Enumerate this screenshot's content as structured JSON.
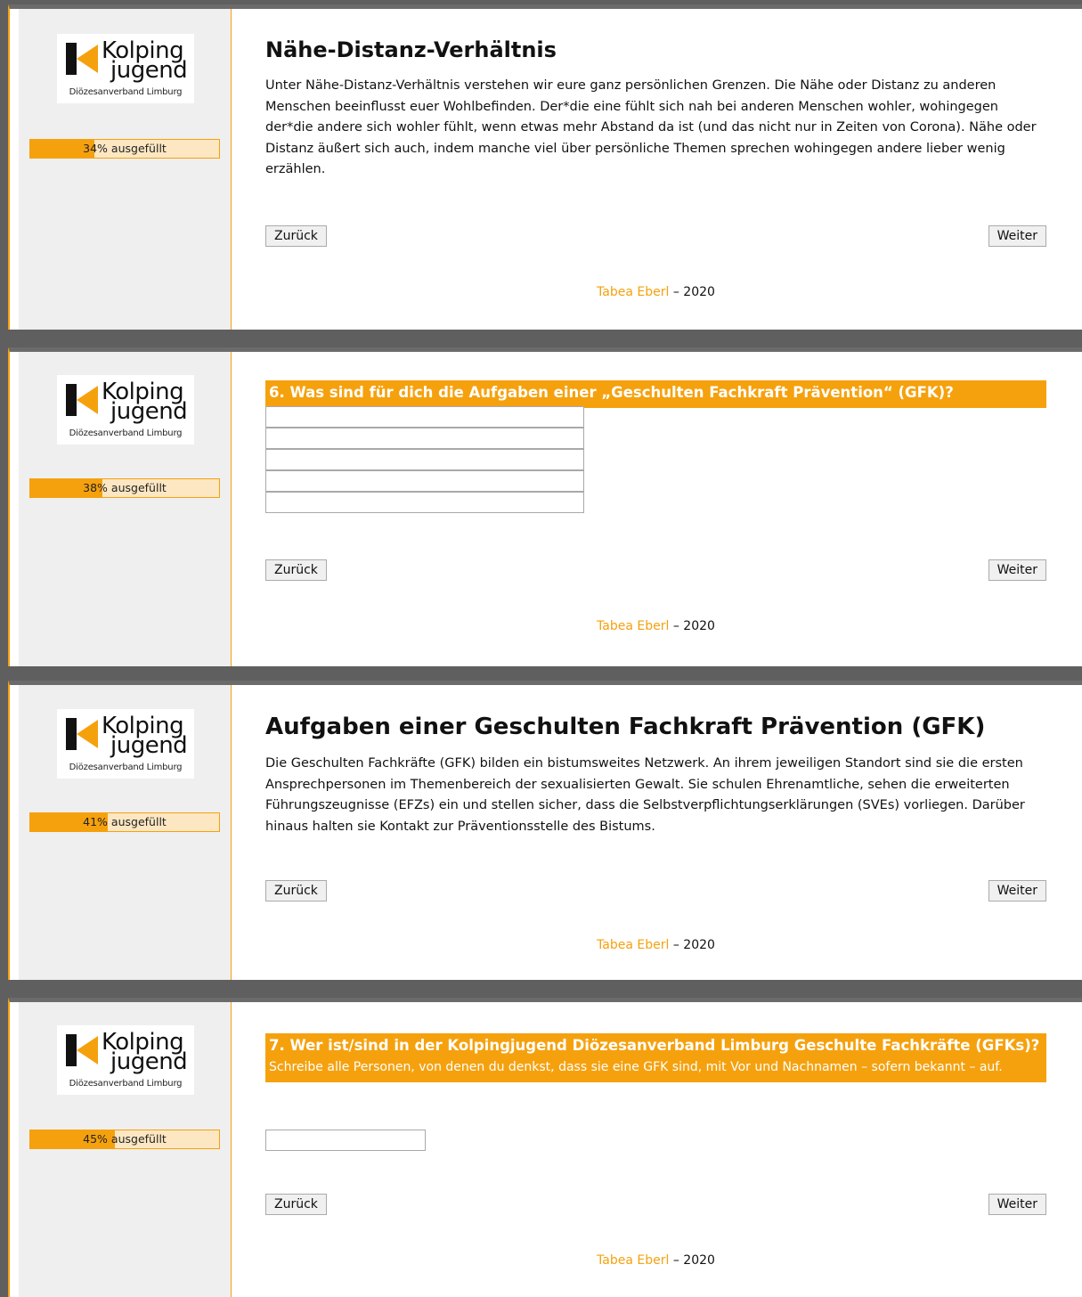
{
  "logo": {
    "line1": "Kolping",
    "line2": "jugend",
    "subtitle": "Diözesanverband Limburg"
  },
  "colors": {
    "accent": "#f5a10e",
    "sidebar": "#efefef",
    "frame": "#6b6b6b"
  },
  "footer": {
    "author": "Tabea Eberl",
    "sep": " – ",
    "year": "2020"
  },
  "buttons": {
    "back": "Zurück",
    "next": "Weiter"
  },
  "screens": [
    {
      "progress": {
        "percent": "34%",
        "label": " ausgefüllt",
        "value": 34
      },
      "title": "Nähe-Distanz-Verhältnis",
      "text": "Unter Nähe-Distanz-Verhältnis verstehen wir eure ganz persönlichen Grenzen. Die Nähe oder Distanz zu anderen Menschen beeinflusst euer Wohlbefinden. Der*die eine fühlt sich nah bei anderen Menschen wohler, wohingegen der*die andere sich wohler fühlt, wenn etwas mehr Abstand da ist (und das nicht nur in Zeiten von Corona). Nähe oder Distanz äußert sich auch, indem manche viel über persönliche Themen sprechen wohingegen andere lieber wenig erzählen."
    },
    {
      "progress": {
        "percent": "38%",
        "label": " ausgefüllt",
        "value": 38
      },
      "question": "6. Was sind für dich die Aufgaben einer „Geschulten Fachkraft Prävention“ (GFK)?",
      "inputs": [
        "",
        "",
        "",
        "",
        ""
      ]
    },
    {
      "progress": {
        "percent": "41%",
        "label": " ausgefüllt",
        "value": 41
      },
      "title": "Aufgaben einer Geschulten Fachkraft Prävention (GFK)",
      "text": "Die Geschulten Fachkräfte (GFK) bilden ein bistumsweites Netzwerk. An ihrem jeweiligen Standort sind sie die ersten Ansprechpersonen im Themenbereich der sexualisierten Gewalt. Sie schulen Ehrenamtliche, sehen die erweiterten Führungszeugnisse (EFZs) ein und stellen sicher, dass die Selbstverpflichtungserklärungen (SVEs) vorliegen. Darüber hinaus halten sie Kontakt zur Präventionsstelle des Bistums."
    },
    {
      "progress": {
        "percent": "45%",
        "label": " ausgefüllt",
        "value": 45
      },
      "question": "7. Wer ist/sind in der Kolpingjugend Diözesanverband Limburg Geschulte Fachkräfte (GFKs)?",
      "hint": "Schreibe alle Personen, von denen du denkst, dass sie eine GFK sind, mit Vor und Nachnamen – sofern bekannt – auf.",
      "input": ""
    }
  ]
}
